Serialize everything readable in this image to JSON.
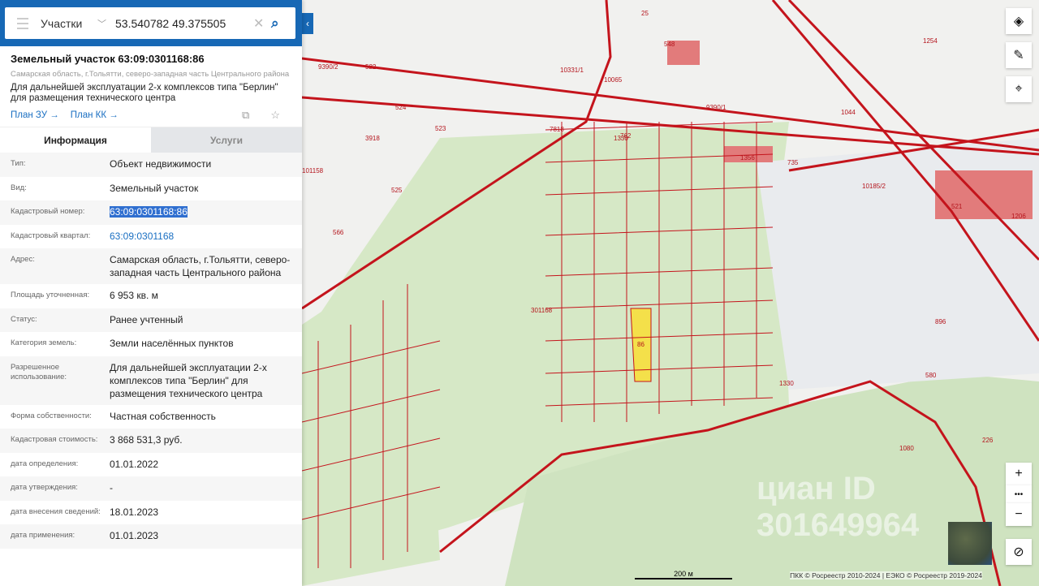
{
  "search": {
    "layer": "Участки",
    "query": "53.540782 49.375505"
  },
  "object": {
    "title": "Земельный участок 63:09:0301168:86",
    "address_short": "Самарская область, г.Тольятти, северо-западная часть Центрального района",
    "purpose": "Для дальнейшей эксплуатации 2-х комплексов типа \"Берлин\" для размещения технического центра",
    "link_zu": "План ЗУ →",
    "link_kk": "План КК →"
  },
  "tabs": [
    {
      "label": "Информация"
    },
    {
      "label": "Услуги"
    }
  ],
  "info": [
    {
      "label": "Тип:",
      "value": "Объект недвижимости"
    },
    {
      "label": "Вид:",
      "value": "Земельный участок"
    },
    {
      "label": "Кадастровый номер:",
      "value": "63:09:0301168:86"
    },
    {
      "label": "Кадастровый квартал:",
      "value": "63:09:0301168"
    },
    {
      "label": "Адрес:",
      "value": "Самарская область, г.Тольятти, северо-западная часть Центрального района"
    },
    {
      "label": "Площадь уточненная:",
      "value": "6 953 кв. м"
    },
    {
      "label": "Статус:",
      "value": "Ранее учтенный"
    },
    {
      "label": "Категория земель:",
      "value": "Земли населённых пунктов"
    },
    {
      "label": "Разрешенное использование:",
      "value": "Для дальнейшей эксплуатации 2-х комплексов типа \"Берлин\" для размещения технического центра"
    },
    {
      "label": "Форма собственности:",
      "value": "Частная собственность"
    },
    {
      "label": "Кадастровая стоимость:",
      "value": "3 868 531,3 руб."
    },
    {
      "label": "дата определения:",
      "value": "01.01.2022"
    },
    {
      "label": "дата утверждения:",
      "value": "-"
    },
    {
      "label": "дата внесения сведений:",
      "value": "18.01.2023"
    },
    {
      "label": "дата применения:",
      "value": "01.01.2023"
    }
  ],
  "map": {
    "scale": "200 м",
    "attribution": "ПКК © Росреестр 2010-2024 | ЕЭКО © Росреестр 2019-2024",
    "watermark": "циан ID 301649964",
    "labels": [
      "25",
      "548",
      "1254",
      "9390/2",
      "522",
      "10331/1",
      "10065",
      "9390/1",
      "1044",
      "524",
      "523",
      "3918",
      "101158",
      "525",
      "566",
      "1330",
      "762",
      "1356",
      "735",
      "521",
      "1206",
      "301168",
      "86",
      "1330",
      "580",
      "896",
      "226",
      "1080",
      "7818",
      "10185/2"
    ]
  },
  "controls": {
    "zoom_in": "+",
    "more": "•••",
    "zoom_out": "−"
  }
}
